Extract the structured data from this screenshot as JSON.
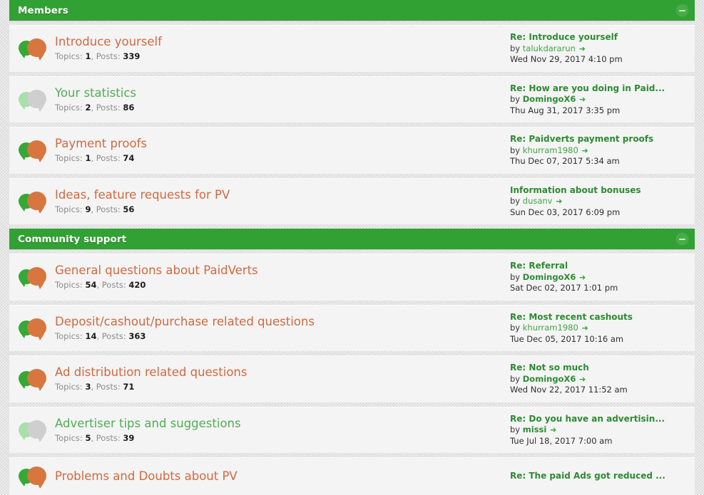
{
  "theme": {
    "header_green": "#31a133",
    "link_orange": "#d1693f",
    "link_green": "#4fae54",
    "lastpost_green": "#2d8b32",
    "row_bg": "#f4f4f4",
    "page_bg": "#e3e3e3"
  },
  "labels": {
    "topics": "Topics:",
    "posts": "Posts:",
    "by": "by",
    "arrow": "➜",
    "collapse_icon": "minus-icon"
  },
  "sections": [
    {
      "title": "Members",
      "collapse_label": "−",
      "forums": [
        {
          "title": "Introduce yourself",
          "state": "unread",
          "topics": "1",
          "posts": "339",
          "lastpost": {
            "title": "Re: Introduce yourself",
            "user": "talukdararun",
            "user_bold": false,
            "date": "Wed Nov 29, 2017 4:10 pm"
          }
        },
        {
          "title": "Your statistics",
          "state": "read",
          "topics": "2",
          "posts": "86",
          "lastpost": {
            "title": "Re: How are you doing in Paid...",
            "user": "DomingoX6",
            "user_bold": true,
            "date": "Thu Aug 31, 2017 3:35 pm"
          }
        },
        {
          "title": "Payment proofs",
          "state": "unread",
          "topics": "1",
          "posts": "74",
          "lastpost": {
            "title": "Re: Paidverts payment proofs",
            "user": "khurram1980",
            "user_bold": false,
            "date": "Thu Dec 07, 2017 5:34 am"
          }
        },
        {
          "title": "Ideas, feature requests for PV",
          "state": "unread",
          "topics": "9",
          "posts": "56",
          "lastpost": {
            "title": "Information about bonuses",
            "user": "dusanv",
            "user_bold": false,
            "date": "Sun Dec 03, 2017 6:09 pm"
          }
        }
      ]
    },
    {
      "title": "Community support",
      "collapse_label": "−",
      "forums": [
        {
          "title": "General questions about PaidVerts",
          "state": "unread",
          "topics": "54",
          "posts": "420",
          "lastpost": {
            "title": "Re: Referral",
            "user": "DomingoX6",
            "user_bold": true,
            "date": "Sat Dec 02, 2017 1:01 pm"
          }
        },
        {
          "title": "Deposit/cashout/purchase related questions",
          "state": "unread",
          "topics": "14",
          "posts": "363",
          "lastpost": {
            "title": "Re: Most recent cashouts",
            "user": "khurram1980",
            "user_bold": false,
            "date": "Tue Dec 05, 2017 10:16 am"
          }
        },
        {
          "title": "Ad distribution related questions",
          "state": "unread",
          "topics": "3",
          "posts": "71",
          "lastpost": {
            "title": "Re: Not so much",
            "user": "DomingoX6",
            "user_bold": true,
            "date": "Wed Nov 22, 2017 11:52 am"
          }
        },
        {
          "title": "Advertiser tips and suggestions",
          "state": "read",
          "topics": "5",
          "posts": "39",
          "lastpost": {
            "title": "Re: Do you have an advertisin...",
            "user": "missi",
            "user_bold": true,
            "date": "Tue Jul 18, 2017 7:00 am"
          }
        },
        {
          "title": "Problems and Doubts about PV",
          "state": "unread",
          "topics": "",
          "posts": "",
          "lastpost": {
            "title": "Re: The paid Ads got reduced ...",
            "user": "",
            "user_bold": false,
            "date": ""
          }
        }
      ]
    }
  ]
}
